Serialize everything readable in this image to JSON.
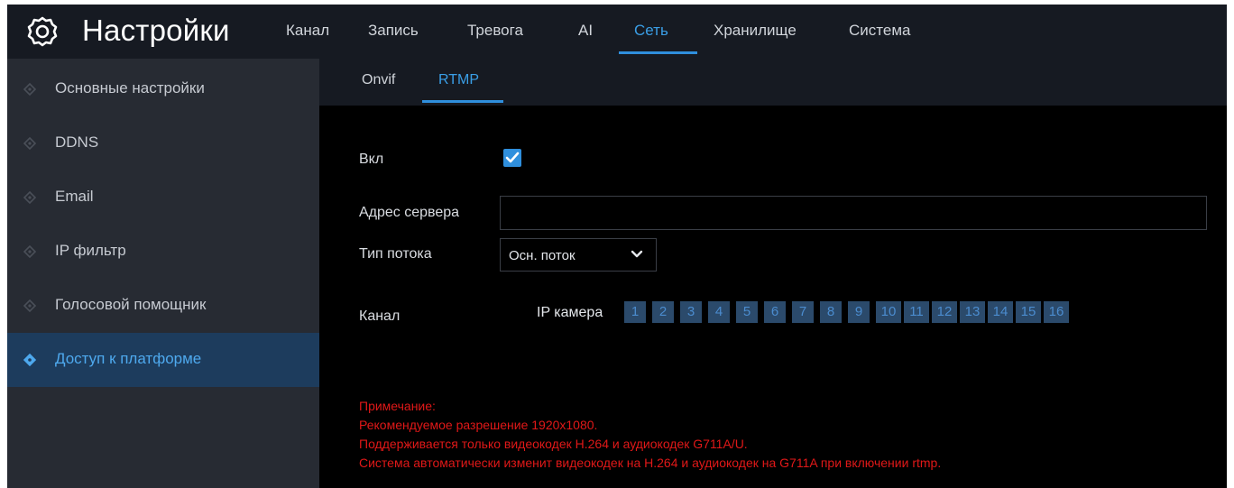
{
  "app": {
    "title": "Настройки",
    "logo_icon": "gear-icon"
  },
  "nav": {
    "tabs": [
      {
        "label": "Канал"
      },
      {
        "label": "Запись"
      },
      {
        "label": "Тревога"
      },
      {
        "label": "AI"
      },
      {
        "label": "Сеть",
        "active": true
      },
      {
        "label": "Хранилище"
      },
      {
        "label": "Система"
      }
    ]
  },
  "sidebar": {
    "items": [
      {
        "label": "Основные настройки"
      },
      {
        "label": "DDNS"
      },
      {
        "label": "Email"
      },
      {
        "label": "IP фильтр"
      },
      {
        "label": "Голосовой помощник"
      },
      {
        "label": "Доступ к платформе",
        "active": true
      }
    ]
  },
  "subtabs": [
    {
      "label": "Onvif"
    },
    {
      "label": "RTMP",
      "active": true
    }
  ],
  "form": {
    "enable_label": "Вкл",
    "enable_checked": true,
    "server_label": "Адрес сервера",
    "server_value": "",
    "stream_label": "Тип потока",
    "stream_value": "Осн. поток",
    "channel_label": "Канал",
    "ipcam_label": "IP камера",
    "channels": [
      "1",
      "2",
      "3",
      "4",
      "5",
      "6",
      "7",
      "8",
      "9",
      "10",
      "11",
      "12",
      "13",
      "14",
      "15",
      "16"
    ]
  },
  "notes": {
    "title": "Примечание:",
    "line1": "Рекомендуемое разрешение 1920x1080.",
    "line2": "Поддерживается только видеокодек H.264 и аудиокодек G711A/U.",
    "line3": "Система автоматически изменит видеокодек на H.264 и аудиокодек на G711A при включении rtmp."
  },
  "colors": {
    "accent": "#2f8fdd",
    "sidebar_bg": "#272b33",
    "topbar_bg": "#161a22",
    "note_red": "#e01818",
    "channel_box": "#2b4a6b"
  }
}
